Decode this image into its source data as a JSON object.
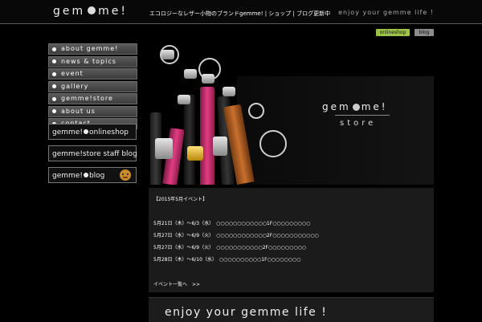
{
  "header": {
    "logo_left": "gem",
    "logo_right": "me!",
    "description": "エコロジーなレザー小物のブランドgemme! | ショップ | ブログ更新中",
    "tagline": "enjoy your gemme life !"
  },
  "top_links": {
    "onlineshop": "onlineshop",
    "blog": "blog"
  },
  "nav": {
    "items": [
      {
        "label": "about gemme!"
      },
      {
        "label": "news & topics"
      },
      {
        "label": "event"
      },
      {
        "label": "gallery"
      },
      {
        "label": "gemme!store"
      },
      {
        "label": "about us"
      },
      {
        "label": "contact"
      }
    ]
  },
  "banners": {
    "online_left": "gemme!",
    "online_right": "onlineshop",
    "staff_blog": "gemme!store staff blog",
    "blog_left": "gemme!",
    "blog_right": "blog"
  },
  "hero": {
    "logo_left": "gem",
    "logo_right": "me!",
    "store": "store"
  },
  "news": {
    "title": "【2015年5月イベント】",
    "lines": [
      "5月21日（木）〜6/3（水）　○○○○○○○○○○○○1F○○○○○○○○○",
      "5月27日（水）〜6/9（火）　○○○○○○○○○○○○2F○○○○○○○○○○○",
      "5月27日（水）〜6/9（火）　○○○○○○○○○○○2F○○○○○○○○○",
      "5月28日（木）〜6/10（水）　○○○○○○○○○○1F○○○○○○○○"
    ],
    "more": "イベント一覧へ　>>"
  },
  "footer": {
    "text": "enjoy your gemme life !"
  },
  "colors": {
    "accent_green": "#9cc246",
    "gray_button": "#8d8d8d"
  }
}
